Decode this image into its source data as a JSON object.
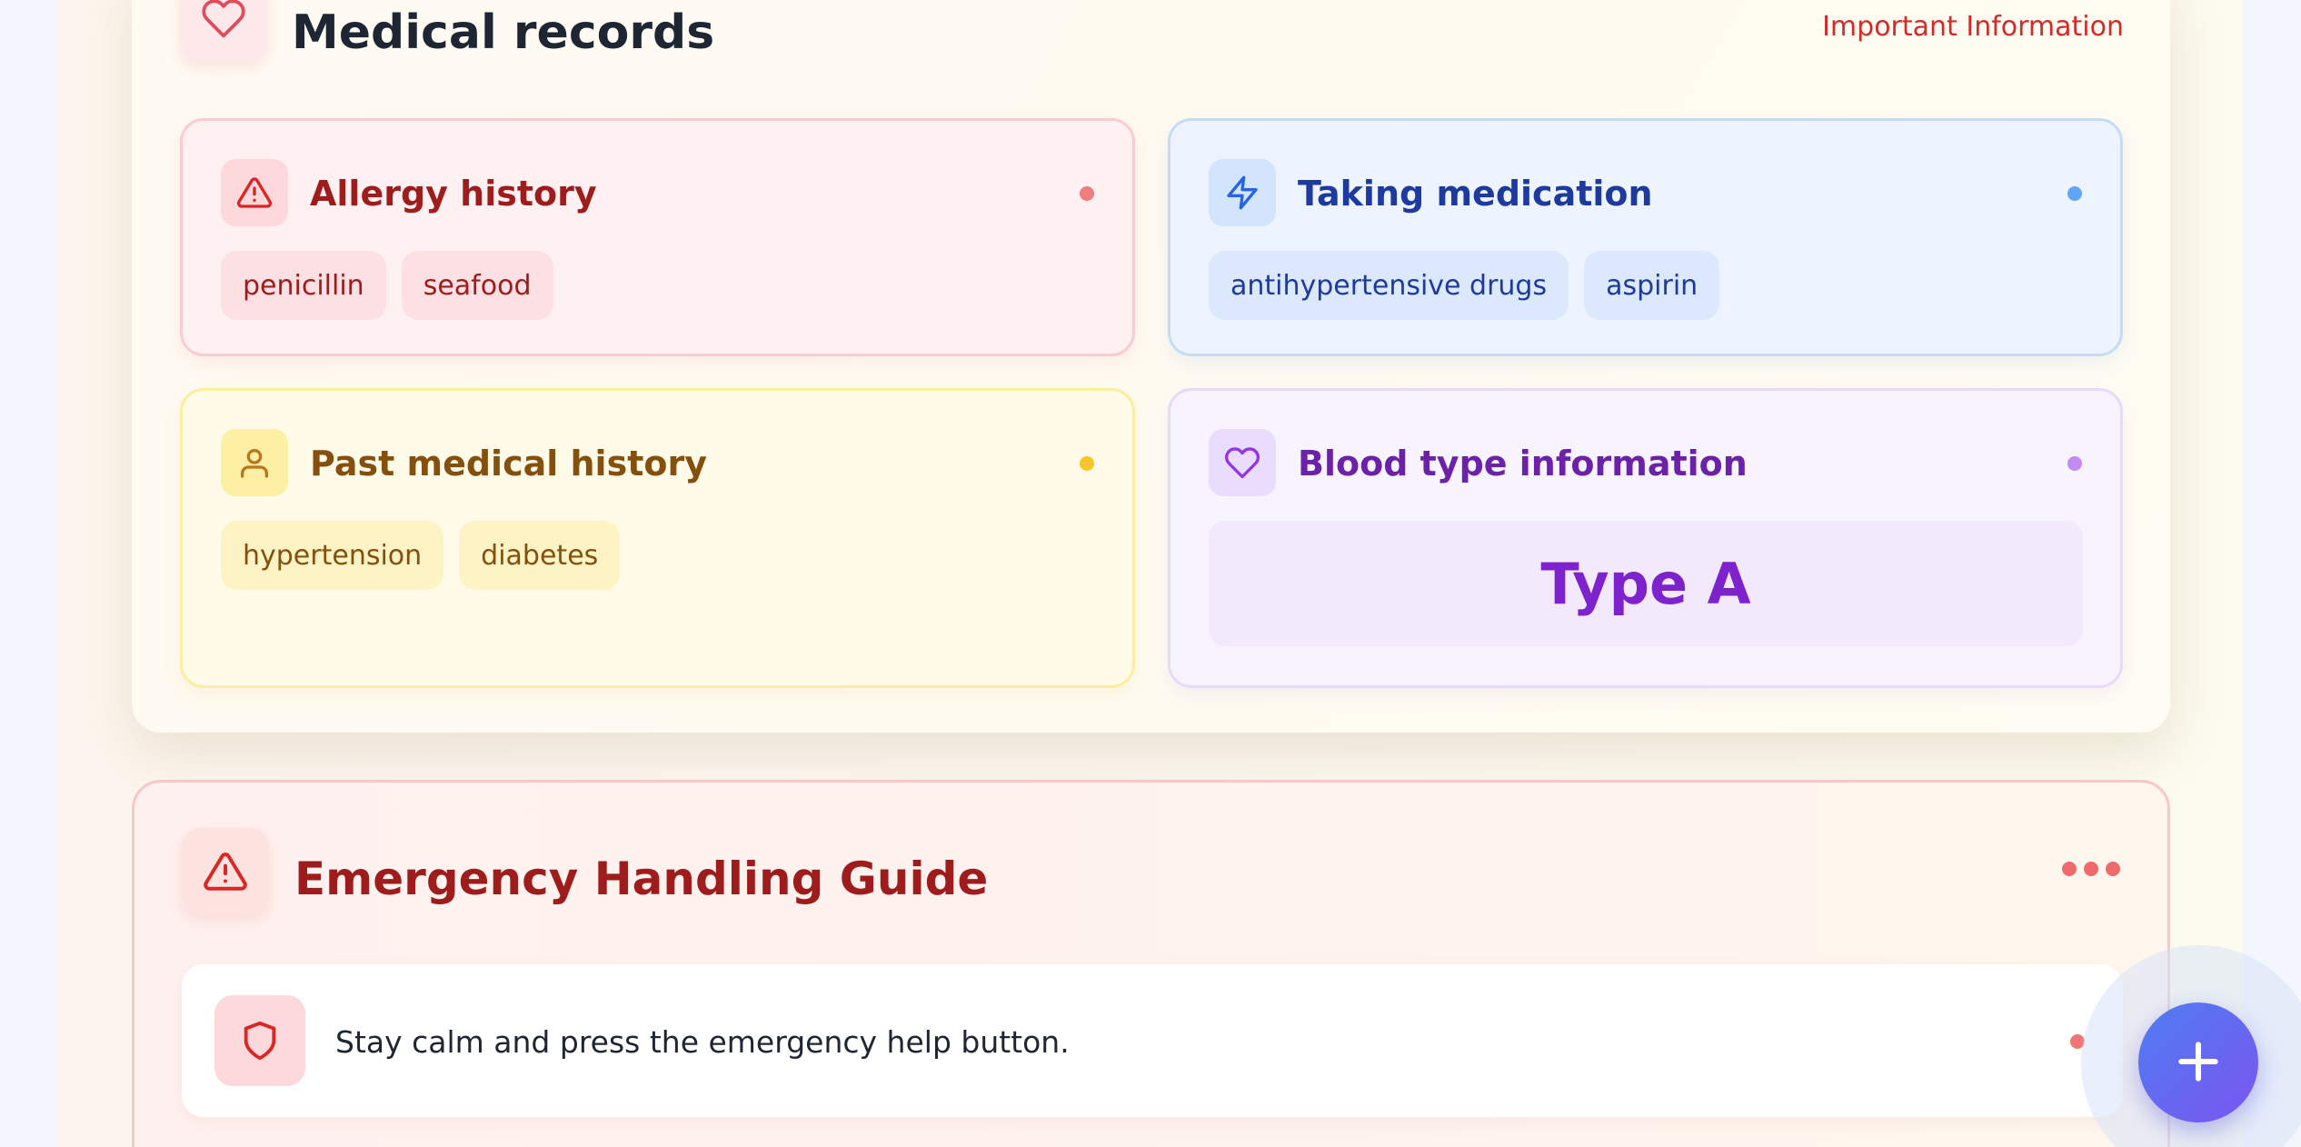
{
  "records": {
    "title": "Medical records",
    "header_icon": "heart-icon",
    "important_label": "Important Information"
  },
  "allergy": {
    "title": "Allergy history",
    "icon": "alert-triangle-icon",
    "accent": "#9e1c1c",
    "items": [
      "penicillin",
      "seafood"
    ]
  },
  "medication": {
    "title": "Taking medication",
    "icon": "lightning-icon",
    "accent": "#1e3a9e",
    "items": [
      "antihypertensive drugs",
      "aspirin"
    ]
  },
  "past_history": {
    "title": "Past medical history",
    "icon": "user-icon",
    "accent": "#85500e",
    "items": [
      "hypertension",
      "diabetes"
    ]
  },
  "blood": {
    "title": "Blood type information",
    "icon": "heart-icon",
    "accent": "#7e22ce",
    "value": "Type A"
  },
  "guide": {
    "title": "Emergency Handling Guide",
    "icon": "alert-triangle-icon",
    "accent": "#9e1c1c",
    "steps": [
      {
        "icon": "shield-icon",
        "text": "Stay calm and press the emergency help button."
      }
    ]
  },
  "fab": {
    "icon": "plus-icon"
  }
}
